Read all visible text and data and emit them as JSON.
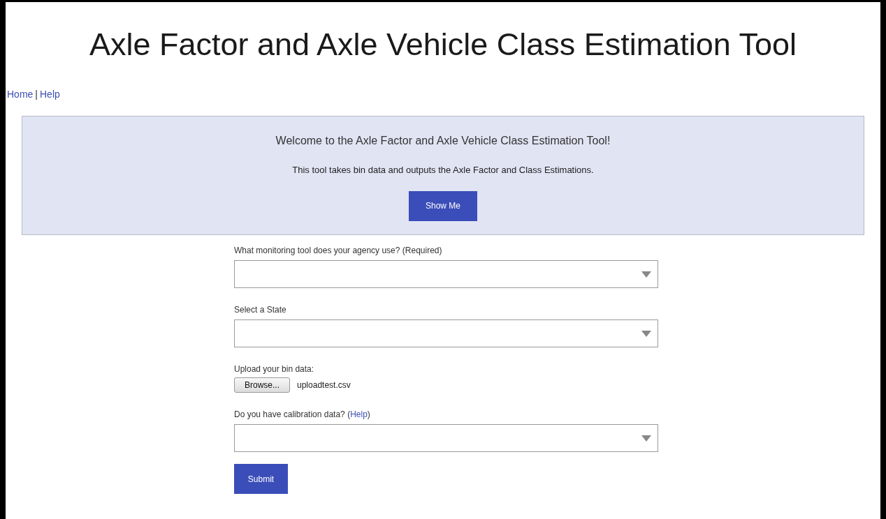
{
  "title": "Axle Factor and Axle Vehicle Class Estimation Tool",
  "nav": [
    "Home",
    "Help"
  ],
  "nav_separator": "|",
  "welcome": {
    "heading": "Welcome to the Axle Factor and Axle Vehicle Class Estimation Tool!",
    "text": "This tool takes bin data and outputs the Axle Factor and Class Estimations.",
    "button": "Show Me"
  },
  "fields": [
    {
      "kind": "select",
      "label": "What monitoring tool does your agency use? (Required)"
    },
    {
      "kind": "select",
      "label": "Select a State"
    },
    {
      "kind": "file",
      "label": "Upload your bin data:",
      "button": "Browse...",
      "value": "uploadtest.csv"
    },
    {
      "kind": "select",
      "label": "Do you have calibration data?",
      "link_prefix": "(",
      "link": "Help",
      "link_suffix": ")"
    }
  ],
  "submit": "Submit"
}
